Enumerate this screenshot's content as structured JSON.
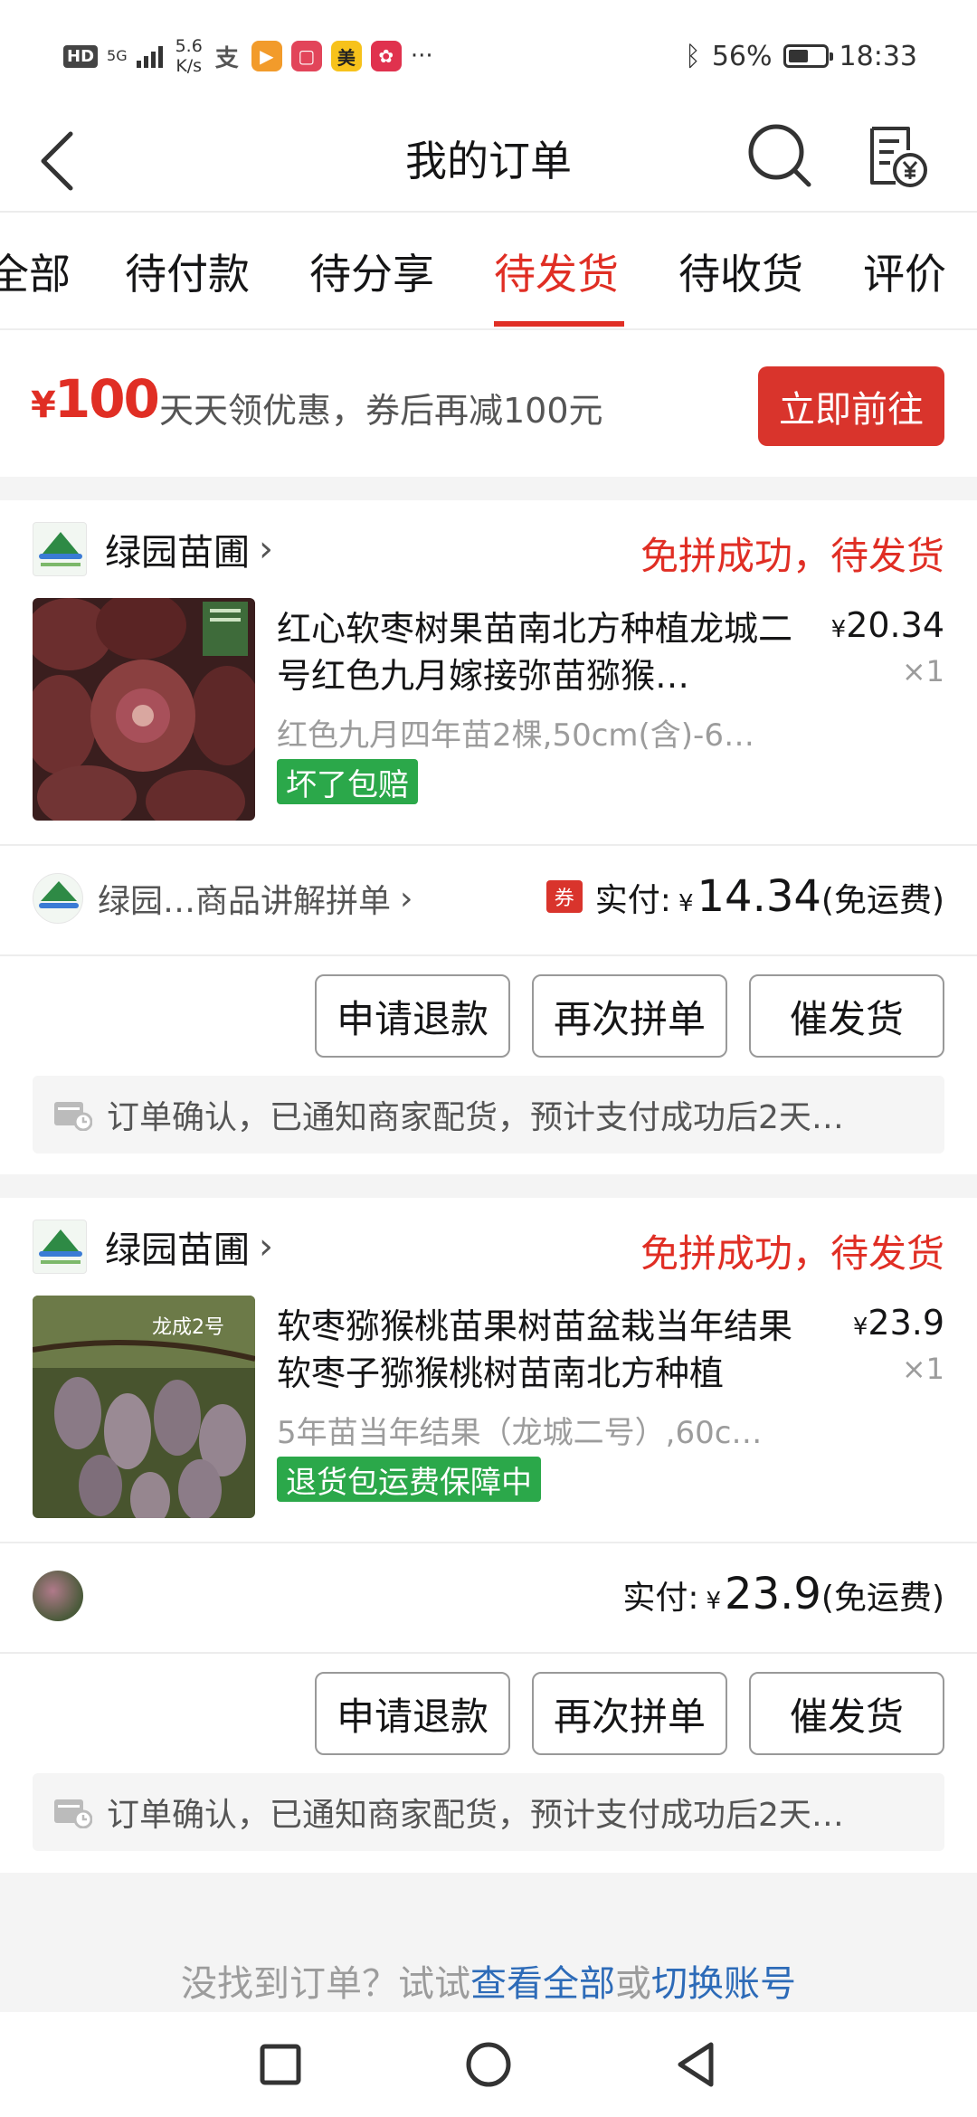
{
  "status_bar": {
    "hd": "HD",
    "net_type": "5G",
    "speed_value": "5.6",
    "speed_unit": "K/s",
    "apps": [
      "alipay-icon",
      "video-app-icon",
      "note-app-icon",
      "meituan-icon",
      "gift-app-icon"
    ],
    "meituan_label": "美",
    "more": "···",
    "battery_pct": "56%",
    "battery_level": 0.56,
    "time": "18:33"
  },
  "header": {
    "title": "我的订单"
  },
  "tabs": [
    {
      "label": "全部"
    },
    {
      "label": "待付款"
    },
    {
      "label": "待分享"
    },
    {
      "label": "待发货",
      "active": true
    },
    {
      "label": "待收货"
    },
    {
      "label": "评价"
    }
  ],
  "coupon": {
    "symbol": "¥",
    "amount": "100",
    "text": "天天领优惠，券后再减100元",
    "button": "立即前往"
  },
  "orders": [
    {
      "shop": "绿园苗圃",
      "status": "免拼成功，待发货",
      "title": "红心软枣树果苗南北方种植龙城二号红色九月嫁接弥苗猕猴…",
      "price_symbol": "¥",
      "price": "20.34",
      "qty": "×1",
      "spec": "红色九月四年苗2棵,50cm(含)-6…",
      "tag": "坏了包赔",
      "pay_left": "绿园…商品讲解拼单",
      "coupon_badge": "券",
      "pay_label": "实付:",
      "pay_symbol": "¥",
      "pay_amount": "14.34",
      "pay_note": "(免运费)",
      "buttons": [
        "申请退款",
        "再次拼单",
        "催发货"
      ],
      "notice": "订单确认，已通知商家配货，预计支付成功后2天…"
    },
    {
      "shop": "绿园苗圃",
      "status": "免拼成功，待发货",
      "title": "软枣猕猴桃苗果树苗盆栽当年结果软枣子猕猴桃树苗南北方种植",
      "img_label": "龙成2号",
      "price_symbol": "¥",
      "price": "23.9",
      "qty": "×1",
      "spec": "5年苗当年结果（龙城二号）,60c…",
      "tag": "退货包运费保障中",
      "pay_label": "实付:",
      "pay_symbol": "¥",
      "pay_amount": "23.9",
      "pay_note": "(免运费)",
      "buttons": [
        "申请退款",
        "再次拼单",
        "催发货"
      ],
      "notice": "订单确认，已通知商家配货，预计支付成功后2天…"
    }
  ],
  "footer": {
    "prefix": "没找到订单？试试",
    "link1": "查看全部",
    "mid": "或",
    "link2": "切换账号"
  },
  "colors": {
    "accent": "#e02e24",
    "green_tag": "#2ba84a",
    "link": "#2d6bb8"
  }
}
